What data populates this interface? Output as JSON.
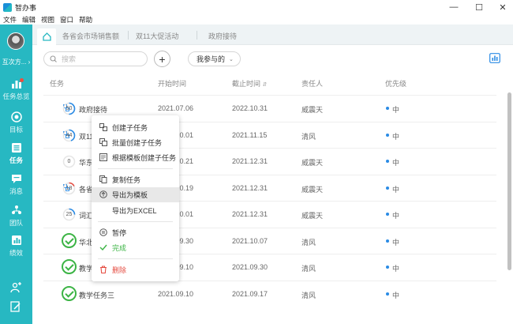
{
  "window": {
    "title": "智办事",
    "controls": [
      "minimize",
      "maximize",
      "close"
    ]
  },
  "menubar": [
    "文件",
    "编辑",
    "视图",
    "窗口",
    "帮助"
  ],
  "sidebar": {
    "username": "互次方...",
    "items": [
      {
        "label": "任务总览",
        "icon": "chart-icon",
        "badge": true
      },
      {
        "label": "目标",
        "icon": "target-icon"
      },
      {
        "label": "任务",
        "icon": "list-icon",
        "active": true
      },
      {
        "label": "消息",
        "icon": "message-icon"
      },
      {
        "label": "团队",
        "icon": "team-icon"
      },
      {
        "label": "绩效",
        "icon": "performance-icon"
      }
    ],
    "bottom_icons": [
      "add-user-icon",
      "edit-icon"
    ]
  },
  "tabs": [
    "各省会市场销售额",
    "双11大促活动",
    "政府接待"
  ],
  "toolbar": {
    "search_placeholder": "搜索",
    "filter_label": "我参与的"
  },
  "table": {
    "columns": [
      "任务",
      "开始时间",
      "截止时间",
      "责任人",
      "优先级"
    ],
    "rows": [
      {
        "status": "progress",
        "progress": 50,
        "linked": true,
        "name": "政府接待",
        "start": "2021.07.06",
        "end": "2022.10.31",
        "owner": "威震天",
        "priority": "中",
        "ring_color": "#2a8be5"
      },
      {
        "status": "progress",
        "progress": 44,
        "linked": true,
        "name": "双11",
        "start": "2021.10.01",
        "end": "2021.11.15",
        "owner": "清风",
        "priority": "中",
        "ring_color": "#2a8be5"
      },
      {
        "status": "progress",
        "progress": 0,
        "linked": false,
        "name": "华东",
        "start": "2021.10.21",
        "end": "2021.12.31",
        "owner": "威震天",
        "priority": "中",
        "ring_color": "#2a8be5"
      },
      {
        "status": "progress",
        "progress": 18,
        "linked": true,
        "name": "各省",
        "start": "2021.10.19",
        "end": "2021.12.31",
        "owner": "威震天",
        "priority": "中",
        "ring_color": "#e54d42"
      },
      {
        "status": "progress",
        "progress": 25,
        "linked": false,
        "name": "词汇",
        "start": "2021.10.01",
        "end": "2021.12.31",
        "owner": "威震天",
        "priority": "中",
        "ring_color": "#2a8be5"
      },
      {
        "status": "done",
        "name": "华北",
        "start": "2021.09.30",
        "end": "2021.10.07",
        "owner": "清风",
        "priority": "中"
      },
      {
        "status": "done",
        "name": "教学",
        "start": "2021.09.10",
        "end": "2021.09.30",
        "owner": "清风",
        "priority": "中"
      },
      {
        "status": "done",
        "name": "教学任务三",
        "start": "2021.09.10",
        "end": "2021.09.17",
        "owner": "清风",
        "priority": "中"
      }
    ]
  },
  "context_menu": [
    {
      "label": "创建子任务",
      "icon": "subtask-icon"
    },
    {
      "label": "批量创建子任务",
      "icon": "batch-subtask-icon"
    },
    {
      "label": "根据模板创建子任务",
      "icon": "template-icon"
    },
    {
      "separator": true
    },
    {
      "label": "复制任务",
      "icon": "copy-icon"
    },
    {
      "label": "导出为模板",
      "icon": "export-icon",
      "hover": true
    },
    {
      "label": "导出为EXCEL",
      "icon": ""
    },
    {
      "separator": true
    },
    {
      "label": "暂停",
      "icon": "pause-icon"
    },
    {
      "label": "完成",
      "icon": "check-icon",
      "color": "green"
    },
    {
      "separator": true
    },
    {
      "label": "删除",
      "icon": "trash-icon",
      "color": "red"
    }
  ],
  "colors": {
    "sidebar": "#27b8c2",
    "accent_blue": "#2a8be5",
    "done_green": "#3cb445",
    "danger_red": "#e54d42"
  }
}
